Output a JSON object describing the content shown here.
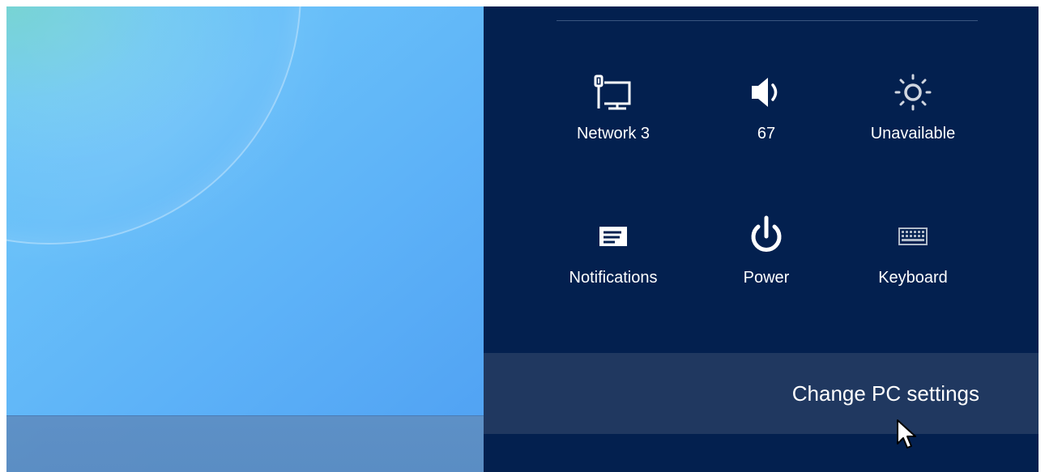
{
  "settings_charm": {
    "quick_settings": [
      {
        "id": "network",
        "label": "Network  3",
        "icon": "network-icon"
      },
      {
        "id": "volume",
        "label": "67",
        "icon": "speaker-icon"
      },
      {
        "id": "brightness",
        "label": "Unavailable",
        "icon": "brightness-icon"
      },
      {
        "id": "notifications",
        "label": "Notifications",
        "icon": "notifications-icon"
      },
      {
        "id": "power",
        "label": "Power",
        "icon": "power-icon"
      },
      {
        "id": "keyboard",
        "label": "Keyboard",
        "icon": "keyboard-icon"
      }
    ],
    "change_pc_settings_label": "Change PC settings"
  },
  "colors": {
    "charm_background": "#03204f",
    "change_bar_hover": "#203860",
    "desktop_blue": "#5db2f8",
    "taskbar": "#5b8cc2"
  }
}
